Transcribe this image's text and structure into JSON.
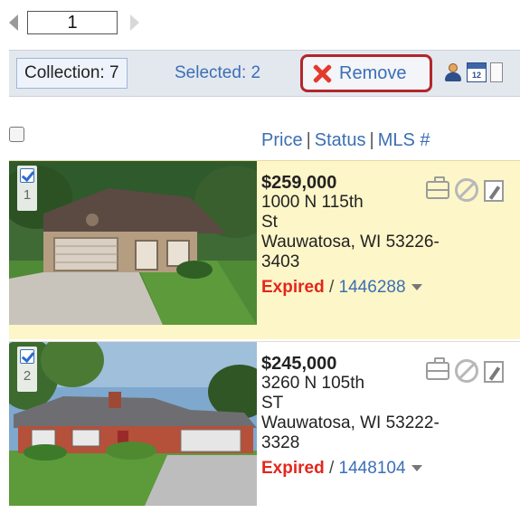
{
  "pager": {
    "current_page": "1"
  },
  "toolbar": {
    "collection_label": "Collection: 7",
    "selected_label": "Selected: 2",
    "remove_label": "Remove",
    "calendar_day": "12"
  },
  "columns": {
    "price": "Price",
    "status": "Status",
    "mls": "MLS #",
    "separator": "|"
  },
  "listings": [
    {
      "index": "1",
      "checked": true,
      "price": "$259,000",
      "address_line1": "1000 N 115th",
      "address_line2": "St",
      "city_line": "Wauwatosa, WI 53226-",
      "zip_ext": "3403",
      "status": "Expired",
      "mls": "1446288",
      "highlighted": true
    },
    {
      "index": "2",
      "checked": true,
      "price": "$245,000",
      "address_line1": "3260 N 105th",
      "address_line2": "ST",
      "city_line": "Wauwatosa, WI 53222-",
      "zip_ext": "3328",
      "status": "Expired",
      "mls": "1448104",
      "highlighted": false
    }
  ],
  "colors": {
    "accent_blue": "#3b6fb5",
    "status_red": "#e3261c",
    "highlight_yellow": "#fdf6c8",
    "remove_border": "#b3262c"
  }
}
